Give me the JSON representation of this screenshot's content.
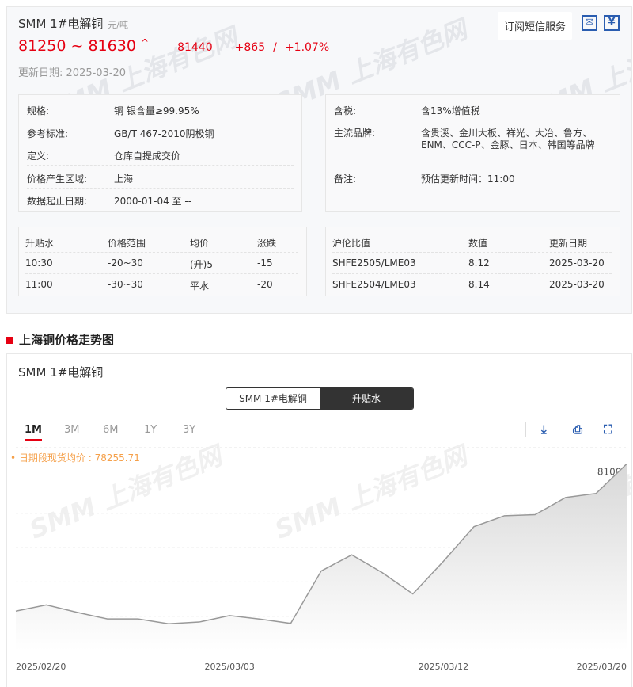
{
  "header": {
    "title": "SMM 1#电解铜",
    "unit": "元/吨",
    "price_low": "81250",
    "price_high": "81630",
    "separator": "~",
    "arrow": "^",
    "avg_price": "81440",
    "change": "+865",
    "change_pct": "+1.07%",
    "update_label": "更新日期:",
    "update_date": "2025-03-20",
    "subscribe": "订阅短信服务",
    "mail_icon": "mail-icon",
    "price_icon": "yuan-calendar-icon"
  },
  "watermark": "SMM 上海有色网",
  "spec_left": [
    {
      "label": "规格:",
      "value": "铜 银含量≥99.95%"
    },
    {
      "label": "参考标准:",
      "value": "GB/T 467-2010阴极铜"
    },
    {
      "label": "定义:",
      "value": "仓库自提成交价"
    },
    {
      "label": "价格产生区域:",
      "value": "上海"
    },
    {
      "label": "数据起止日期:",
      "value": "2000-01-04 至 --"
    }
  ],
  "spec_right": [
    {
      "label": "含税:",
      "value": "含13%增值税"
    },
    {
      "label": "主流品牌:",
      "value": "含贵溪、金川大板、祥光、大冶、鲁方、",
      "value2": "ENM、CCC-P、金豚、日本、韩国等品牌"
    },
    {
      "label": "备注:",
      "value": "预估更新时间：11:00"
    }
  ],
  "premium": {
    "headers": [
      "升贴水",
      "价格范围",
      "均价",
      "涨跌"
    ],
    "rows": [
      [
        "10:30",
        "-20~30",
        "(升)5",
        "-15"
      ],
      [
        "11:00",
        "-30~30",
        "平水",
        "-20"
      ]
    ]
  },
  "ratio": {
    "headers": [
      "沪伦比值",
      "数值",
      "更新日期"
    ],
    "rows": [
      [
        "SHFE2505/LME03",
        "8.12",
        "2025-03-20"
      ],
      [
        "SHFE2504/LME03",
        "8.14",
        "2025-03-20"
      ]
    ]
  },
  "section_title": "上海铜价格走势图",
  "chart_panel": {
    "title": "SMM 1#电解铜",
    "toggle": [
      "SMM 1#电解铜",
      "升贴水"
    ],
    "ranges": [
      "1M",
      "3M",
      "6M",
      "1Y",
      "3Y"
    ],
    "active_range": "1M",
    "avg_label": "• 日期段现货均价 : 78255.71"
  },
  "chart_data": {
    "type": "area",
    "title": "SMM 1#电解铜",
    "x": [
      "2025/02/20",
      "2025/02/21",
      "2025/02/24",
      "2025/02/25",
      "2025/02/26",
      "2025/02/27",
      "2025/02/28",
      "2025/03/03",
      "2025/03/04",
      "2025/03/05",
      "2025/03/06",
      "2025/03/07",
      "2025/03/10",
      "2025/03/11",
      "2025/03/12",
      "2025/03/13",
      "2025/03/14",
      "2025/03/17",
      "2025/03/18",
      "2025/03/19",
      "2025/03/20"
    ],
    "values": [
      77150,
      77330,
      77115,
      76920,
      76920,
      76780,
      76830,
      77020,
      76915,
      76790,
      78320,
      78790,
      78270,
      77650,
      78600,
      79610,
      79930,
      79960,
      80460,
      80580,
      81440
    ],
    "xticks": [
      "2025/02/20",
      "2025/03/03",
      "2025/03/12",
      "2025/03/20"
    ],
    "yticks": [
      76000,
      77000,
      78000,
      79000,
      80000,
      81000
    ],
    "ylim": [
      76000,
      81300
    ],
    "grid": true,
    "color": "#999999"
  }
}
